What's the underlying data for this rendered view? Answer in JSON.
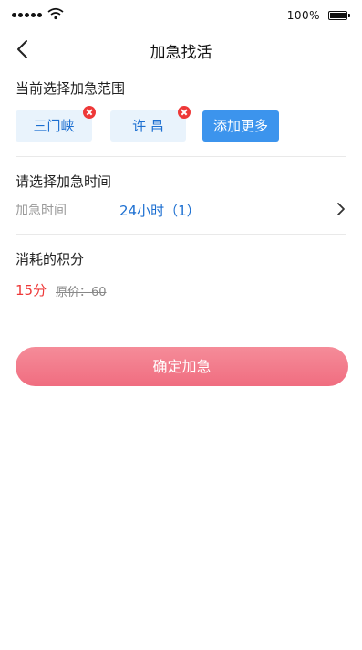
{
  "status_bar": {
    "battery_text": "100%",
    "signal_icon": "signal-dots-icon",
    "wifi_icon": "wifi-icon",
    "battery_icon": "battery-icon",
    "battery_level": 1.0
  },
  "nav": {
    "title": "加急找活",
    "back_icon": "chevron-left-icon"
  },
  "range_section": {
    "title": "当前选择加急范围",
    "regions": [
      "三门峡",
      "许 昌"
    ],
    "add_more_label": "添加更多",
    "remove_icon": "close-circle-icon",
    "remove_color": "#ee3838"
  },
  "time_section": {
    "title": "请选择加急时间",
    "label": "加急时间",
    "value": "24小时（1）",
    "chevron_icon": "chevron-right-icon"
  },
  "points_section": {
    "title": "消耗的积分",
    "points": "15分",
    "original_price": "原价：60"
  },
  "confirm_label": "确定加急",
  "colors": {
    "accent": "#3c94ed",
    "link": "#1c6fd1",
    "warning": "#ee3838",
    "button_gradient_start": "#f58c99",
    "button_gradient_end": "#f06d80"
  }
}
